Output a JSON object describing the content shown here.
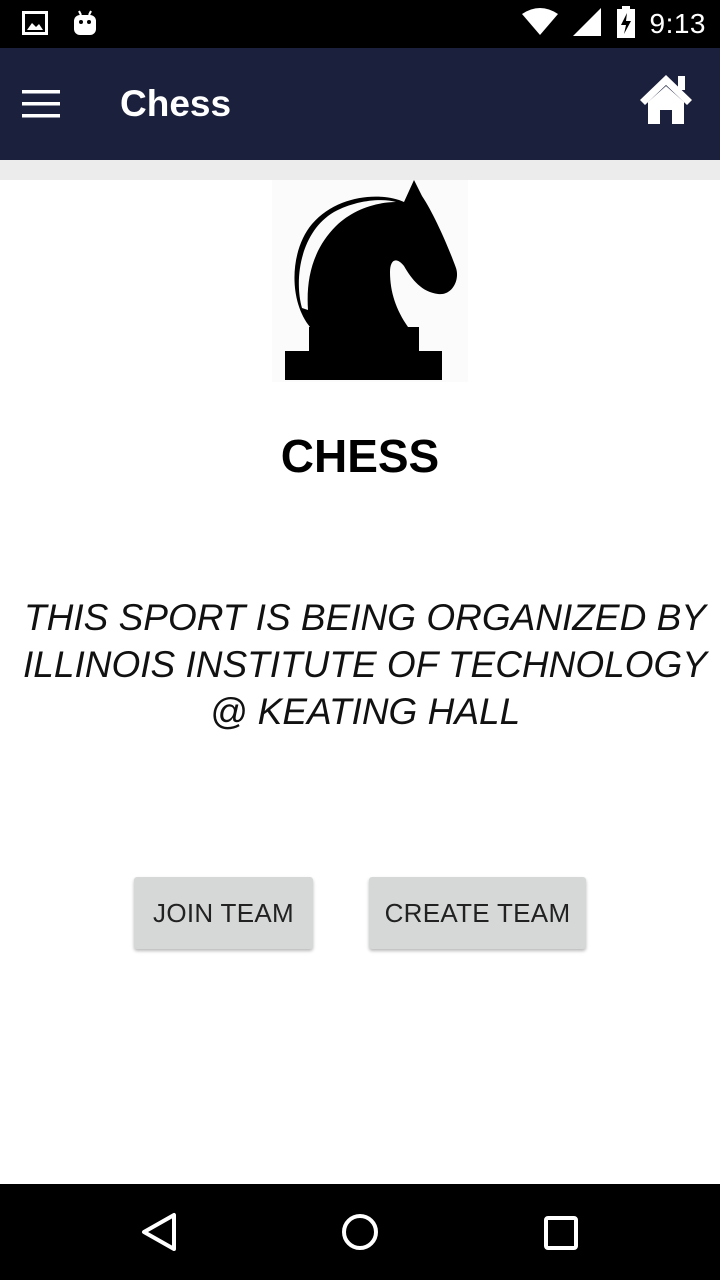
{
  "status_bar": {
    "time": "9:13",
    "icons": [
      "gallery-notification-icon",
      "android-notification-icon",
      "wifi-icon",
      "signal-icon",
      "battery-charging-icon"
    ]
  },
  "app_bar": {
    "title": "Chess",
    "background": "#1b213d",
    "icons": [
      "menu-icon",
      "home-icon"
    ]
  },
  "content": {
    "logo_icon": "chess-knight-icon",
    "sport_title": "CHESS",
    "organizer_text": "THIS SPORT IS BEING ORGANIZED BY ILLINOIS INSTITUTE OF TECHNOLOGY @ KEATING HALL",
    "buttons": {
      "join_label": "JOIN TEAM",
      "create_label": "CREATE TEAM"
    },
    "button_color": "#d6d7d7"
  },
  "nav_bar": {
    "icons": [
      "back-icon",
      "home-circle-icon",
      "recents-icon"
    ]
  }
}
